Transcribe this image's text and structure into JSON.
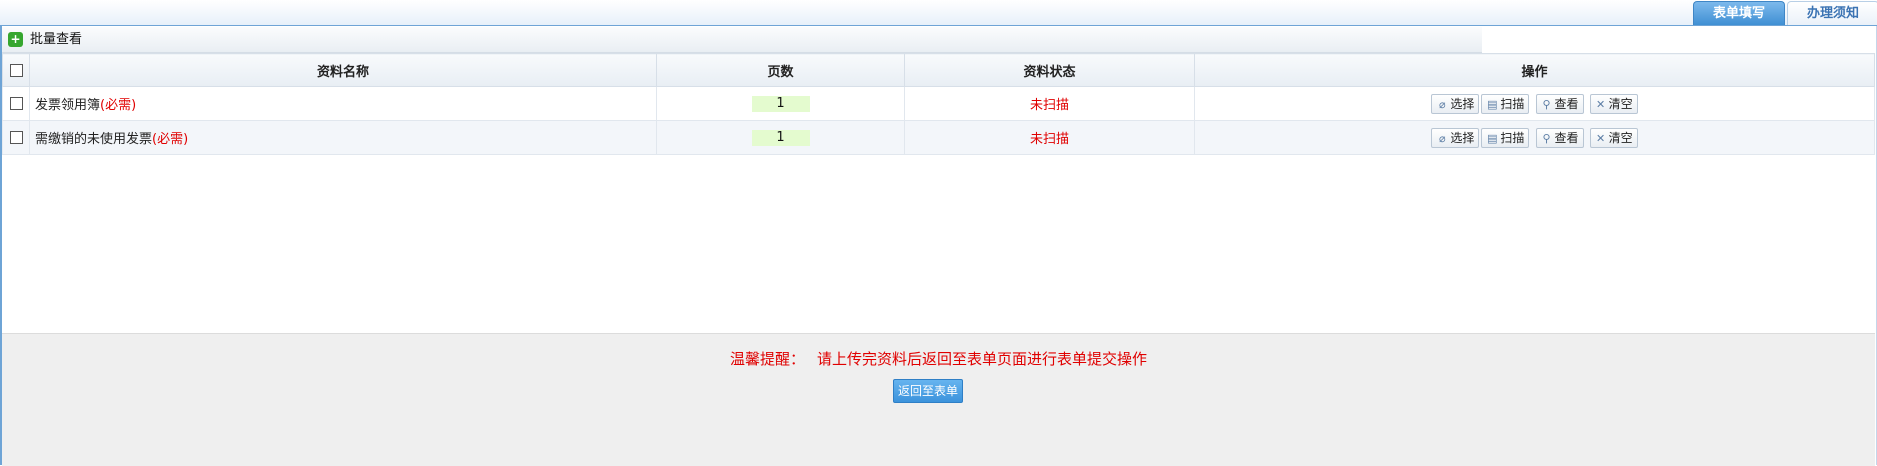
{
  "tabs": [
    {
      "label": "表单填写",
      "active": true
    },
    {
      "label": "办理须知",
      "active": false
    }
  ],
  "batch": {
    "label": "批量查看",
    "icon": "expand-icon"
  },
  "table": {
    "headers": {
      "name": "资料名称",
      "pages": "页数",
      "status": "资料状态",
      "actions": "操作"
    },
    "rows": [
      {
        "name": "发票领用簿",
        "required": "(必需)",
        "pages": "1",
        "status": "未扫描"
      },
      {
        "name": "需缴销的未使用发票",
        "required": "(必需)",
        "pages": "1",
        "status": "未扫描"
      }
    ],
    "actions": {
      "select": "选择",
      "scan": "扫描",
      "view": "查看",
      "clear": "清空"
    }
  },
  "footer": {
    "reminder_title": "温馨提醒：",
    "reminder_text": "请上传完资料后返回至表单页面进行表单提交操作",
    "return_button": "返回至表单"
  },
  "colors": {
    "accent": "#3f8fd3",
    "required": "#e00000",
    "page_badge": "#e4fbcf"
  }
}
